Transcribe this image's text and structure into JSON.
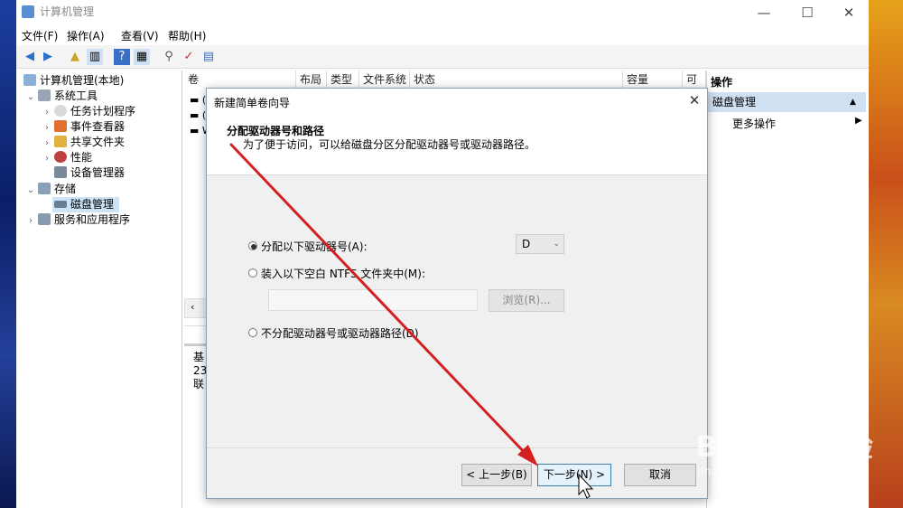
{
  "window": {
    "title": "计算机管理",
    "controls": {
      "minimize": "—",
      "maximize": "☐",
      "close": "✕"
    }
  },
  "menu": {
    "file": "文件(F)",
    "action": "操作(A)",
    "view": "查看(V)",
    "help": "帮助(H)"
  },
  "tree": {
    "root": "计算机管理(本地)",
    "system_tools": "系统工具",
    "task_scheduler": "任务计划程序",
    "event_viewer": "事件查看器",
    "shared_folders": "共享文件夹",
    "performance": "性能",
    "device_manager": "设备管理器",
    "storage": "存储",
    "disk_management": "磁盘管理",
    "services": "服务和应用程序"
  },
  "columns": [
    "卷",
    "布局",
    "类型",
    "文件系统",
    "状态",
    "容量",
    "可"
  ],
  "volume_rows": [
    "(",
    "(",
    "W"
  ],
  "disk_info": [
    "基",
    "23",
    "联"
  ],
  "actions": {
    "header": "操作",
    "selected": "磁盘管理",
    "more": "更多操作"
  },
  "dialog": {
    "title": "新建简单卷向导",
    "close": "✕",
    "heading": "分配驱动器号和路径",
    "subheading": "为了便于访问，可以给磁盘分区分配驱动器号或驱动器路径。",
    "option_assign": "分配以下驱动器号(A):",
    "option_mount": "装入以下空白 NTFS 文件夹中(M):",
    "option_none": "不分配驱动器号或驱动器路径(D)",
    "drive_letter": "D",
    "browse": "浏览(R)...",
    "back": "< 上一步(B)",
    "next": "下一步(N) >",
    "cancel": "取消"
  },
  "watermark": {
    "main": "Bai du 经验",
    "sub": "jingyan.baidu.com"
  },
  "annotation": {
    "arrow_color": "#d42020"
  }
}
